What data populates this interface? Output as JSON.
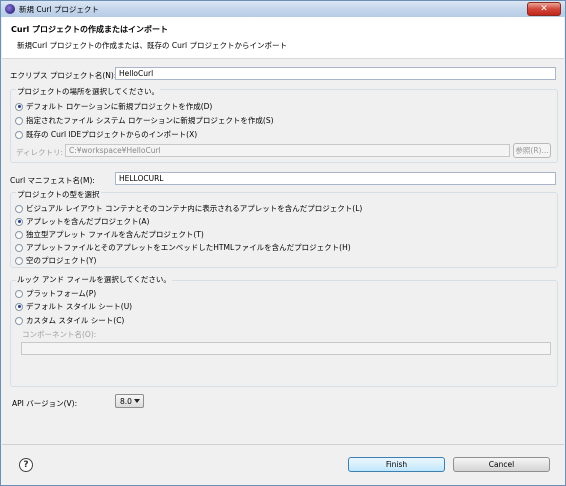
{
  "window": {
    "title": "新規 Curl プロジェクト",
    "close_label": "✕"
  },
  "header": {
    "title": "Curl プロジェクトの作成またはインポート",
    "description": "新規Curl プロジェクトの作成または、既存の Curl プロジェクトからインポート"
  },
  "eclipse_project": {
    "label": "エクリプス プロジェクト名(N):",
    "value": "HelloCurl"
  },
  "location_group": {
    "title": "プロジェクトの場所を選択してください。",
    "options": [
      {
        "label": "デフォルト ロケーションに新規プロジェクトを作成(D)",
        "checked": true
      },
      {
        "label": "指定されたファイル システム ロケーションに新規プロジェクトを作成(S)",
        "checked": false
      },
      {
        "label": "既存の Curl IDEプロジェクトからのインポート(X)",
        "checked": false
      }
    ],
    "directory_label": "ディレクトリ:",
    "directory_value": "C:¥workspace¥HelloCurl",
    "browse_label": "参照(R)..."
  },
  "manifest": {
    "label": "Curl マニフェスト名(M):",
    "value": "HELLOCURL"
  },
  "project_type_group": {
    "title": "プロジェクトの型を選択",
    "options": [
      {
        "label": "ビジュアル レイアウト コンテナとそのコンテナ内に表示されるアプレットを含んだプロジェクト(L)",
        "checked": false
      },
      {
        "label": "アプレットを含んだプロジェクト(A)",
        "checked": true
      },
      {
        "label": "独立型アプレット ファイルを含んだプロジェクト(T)",
        "checked": false
      },
      {
        "label": "アプレットファイルとそのアプレットをエンベッドしたHTMLファイルを含んだプロジェクト(H)",
        "checked": false
      },
      {
        "label": "空のプロジェクト(Y)",
        "checked": false
      }
    ]
  },
  "look_feel_group": {
    "title": "ルック アンド フィールを選択してください。",
    "options": [
      {
        "label": "プラットフォーム(P)",
        "checked": false
      },
      {
        "label": "デフォルト スタイル シート(U)",
        "checked": true
      },
      {
        "label": "カスタム スタイル シート(C)",
        "checked": false
      }
    ],
    "component_label": "コンポーネント名(O):",
    "component_value": ""
  },
  "api_version": {
    "label": "API バージョン(V):",
    "value": "8.0"
  },
  "buttons": {
    "finish": "Finish",
    "cancel": "Cancel",
    "help": "?"
  }
}
